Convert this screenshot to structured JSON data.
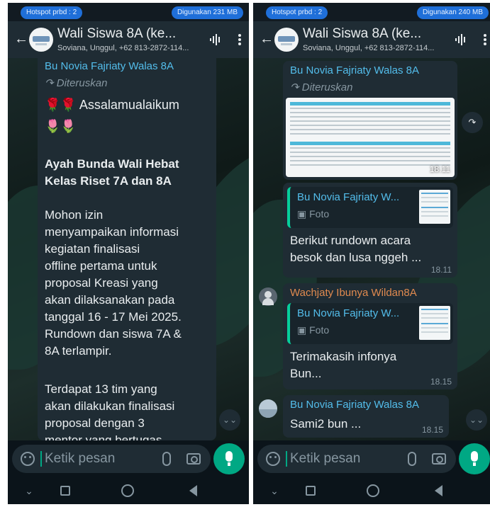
{
  "left": {
    "status": {
      "hotspot": "Hotspot prbd : 2",
      "usage": "Digunakan 231 MB"
    },
    "header": {
      "title": "Wali Siswa 8A (ke...",
      "subtitle": "Soviana, Unggul, +62 813-2872-114..."
    },
    "message": {
      "sender": "Bu Novia Fajriaty Walas 8A",
      "forwarded_label": "Diteruskan",
      "greeting": "🌹🌹 Assalamualaikum",
      "tulips": "🌷🌷",
      "heading_lines": [
        "Ayah Bunda Wali Hebat",
        "Kelas Riset 7A dan 8A"
      ],
      "body_lines": [
        "Mohon izin",
        "menyampaikan informasi",
        "kegiatan finalisasi",
        "offline pertama untuk",
        "proposal Kreasi yang",
        "akan dilaksanakan pada",
        "tanggal 16 - 17 Mei 2025.",
        "Rundown dan siswa 7A &",
        "8A terlampir."
      ],
      "body2_lines": [
        "Terdapat 13 tim yang",
        "akan dilakukan finalisasi",
        "proposal dengan 3",
        "mentor yang bertugas"
      ]
    },
    "input": {
      "placeholder": "Ketik pesan"
    }
  },
  "right": {
    "status": {
      "hotspot": "Hotspot prbd : 2",
      "usage": "Digunakan 240 MB"
    },
    "header": {
      "title": "Wali Siswa 8A (ke...",
      "subtitle": "Soviana, Unggul, +62 813-2872-114..."
    },
    "msg1": {
      "sender": "Bu Novia Fajriaty Walas 8A",
      "forwarded_label": "Diteruskan",
      "image_time": "18.11"
    },
    "msg2": {
      "quote_sender": "Bu Novia Fajriaty W...",
      "quote_media": "Foto",
      "text_lines": [
        "Berikut rundown acara",
        "besok dan lusa nggeh ..."
      ],
      "time": "18.11"
    },
    "msg3": {
      "sender": "Wachjaty Ibunya Wildan8A",
      "quote_sender": "Bu Novia Fajriaty W...",
      "quote_media": "Foto",
      "text_lines": [
        "Terimakasih infonya",
        "Bun..."
      ],
      "time": "18.15"
    },
    "msg4": {
      "sender": "Bu Novia Fajriaty Walas 8A",
      "text": "Sami2 bun ...",
      "time": "18.15"
    },
    "input": {
      "placeholder": "Ketik pesan"
    }
  },
  "colors": {
    "accent_green": "#00a884",
    "sender_blue": "#53bdeb",
    "sender_orange": "#e08a4f",
    "bubble": "#1f2c34",
    "header": "#1f2c34"
  }
}
